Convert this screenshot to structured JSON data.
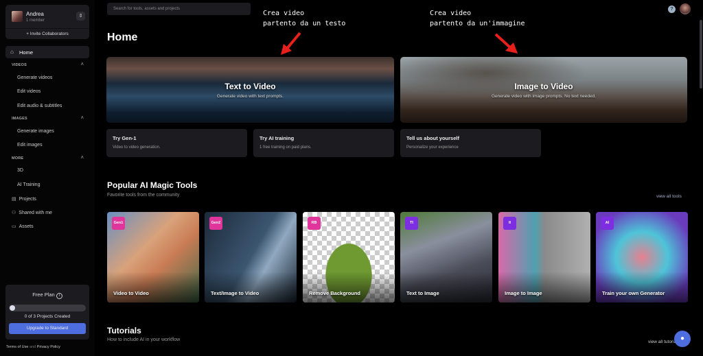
{
  "account": {
    "name": "Andrea",
    "members": "1 member",
    "invite": "+ Invite Collaborators"
  },
  "nav": {
    "home": "Home",
    "sections": [
      {
        "title": "VIDEOS",
        "items": [
          "Generate videos",
          "Edit videos",
          "Edit audio & subtitles"
        ]
      },
      {
        "title": "IMAGES",
        "items": [
          "Generate images",
          "Edit images"
        ]
      },
      {
        "title": "MORE",
        "items": [
          "3D",
          "AI Training"
        ]
      }
    ],
    "bottom": [
      "Projects",
      "Shared with me",
      "Assets"
    ]
  },
  "plan": {
    "title": "Free Plan",
    "progress": 0,
    "count": "0 of 3 Projects Created",
    "upgrade": "Upgrade to Standard"
  },
  "legal": {
    "terms": "Terms of Use",
    "and": "and",
    "privacy": "Privacy Policy"
  },
  "search": {
    "placeholder": "Search for tools, assets and projects"
  },
  "annotations": [
    "Crea video\npartento da un testo",
    "Crea video\npartento da un'immagine"
  ],
  "page_title": "Home",
  "hero": [
    {
      "title": "Text to Video",
      "subtitle": "Generate video with text prompts."
    },
    {
      "title": "Image to Video",
      "subtitle": "Generate video with image prompts. No text needed."
    }
  ],
  "quick": [
    {
      "title": "Try Gen-1",
      "subtitle": "Video to video generation."
    },
    {
      "title": "Try AI training",
      "subtitle": "1 free training on paid plans."
    },
    {
      "title": "Tell us about yourself",
      "subtitle": "Personalize your experience"
    }
  ],
  "popular": {
    "title": "Popular AI Magic Tools",
    "subtitle": "Favorite tools from the community",
    "view_all": "view all tools",
    "tools": [
      {
        "badge": "Gen1",
        "label": "Video to Video",
        "color": "#e0359a"
      },
      {
        "badge": "Gen2",
        "label": "Text/Image to Video",
        "color": "#e0359a"
      },
      {
        "badge": "RB",
        "label": "Remove Background",
        "color": "#e0359a"
      },
      {
        "badge": "TI",
        "label": "Text to Image",
        "color": "#7c2ee0"
      },
      {
        "badge": "II",
        "label": "Image to Image",
        "color": "#7c2ee0"
      },
      {
        "badge": "AI",
        "label": "Train your own Generator",
        "color": "#7c2ee0"
      }
    ]
  },
  "tutorials": {
    "title": "Tutorials",
    "subtitle": "How to include AI in your workflow",
    "view_all": "view all tutorials"
  }
}
